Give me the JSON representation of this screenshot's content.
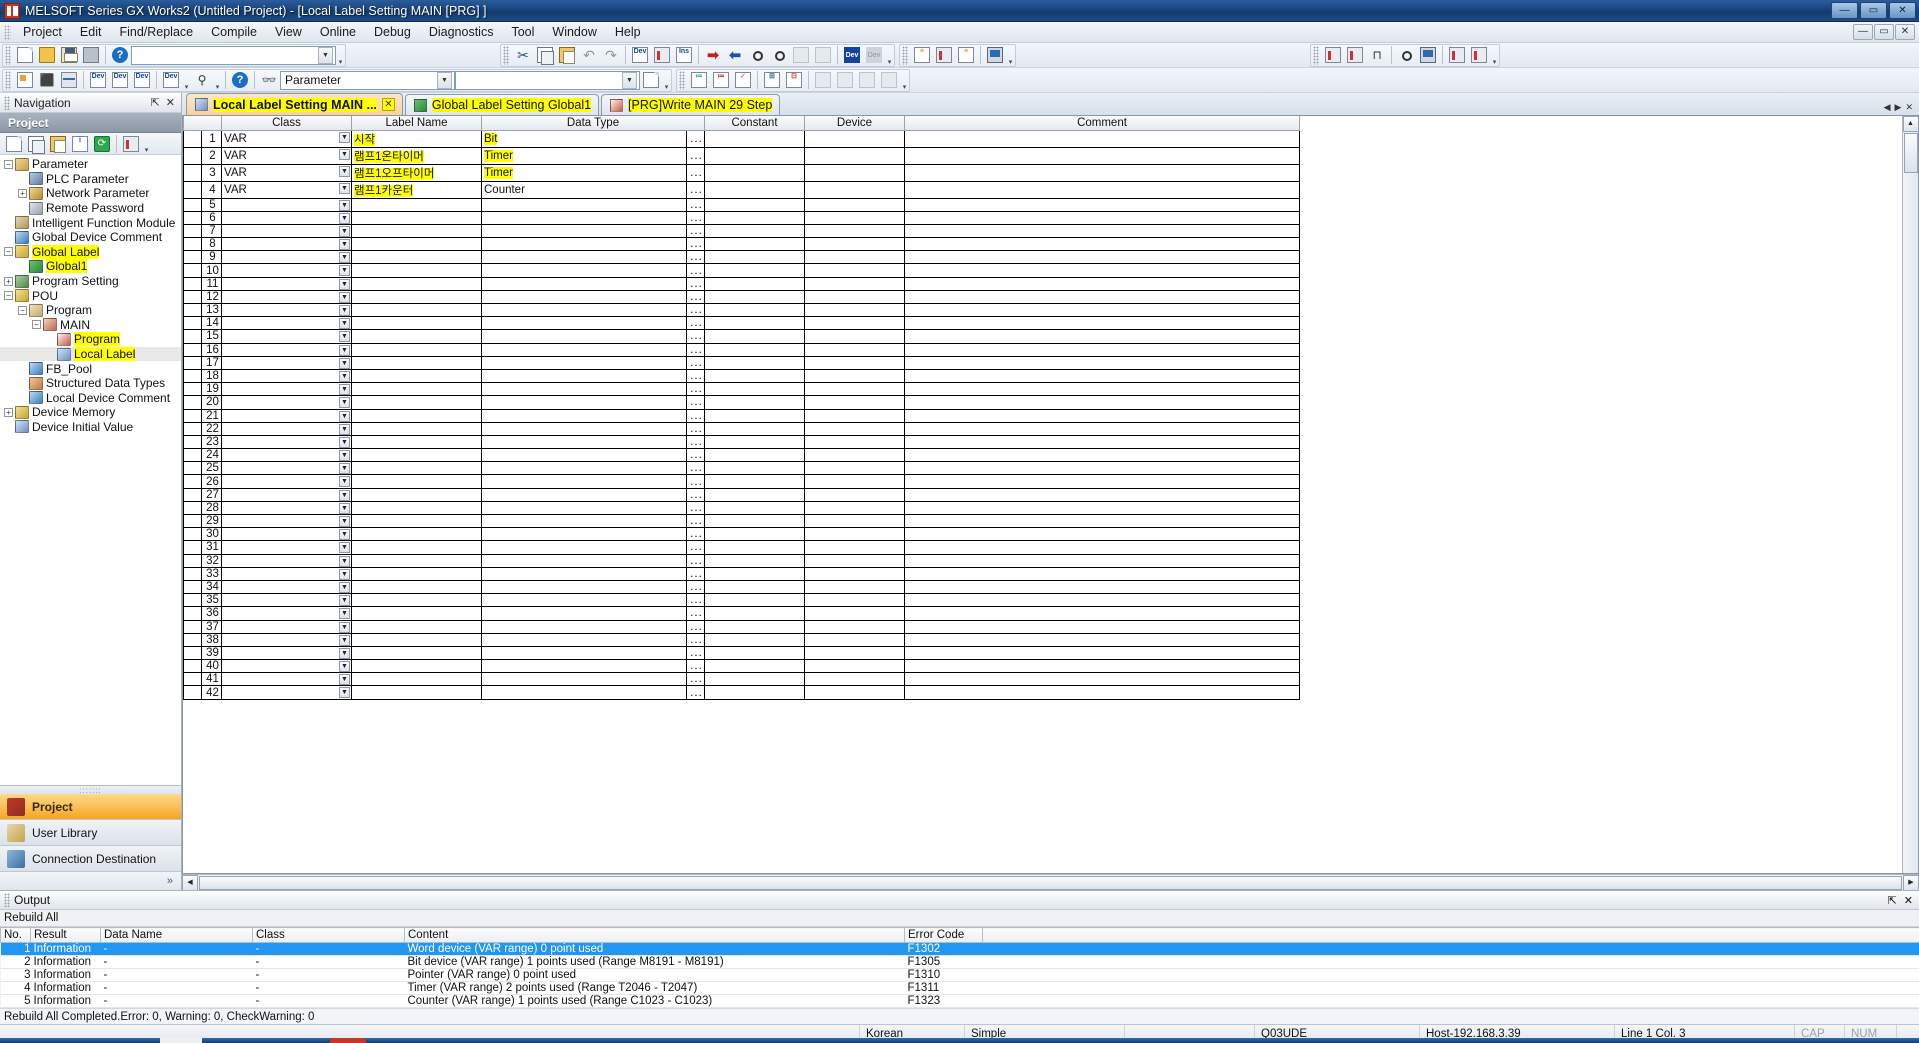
{
  "window": {
    "title": "MELSOFT Series GX Works2 (Untitled Project) - [Local Label Setting MAIN [PRG] ]",
    "app_icon": "gxworks-icon",
    "minimize": "—",
    "maximize": "▭",
    "close": "✕",
    "inner_minimize": "—",
    "inner_restore": "▭",
    "inner_close": "✕"
  },
  "menu": {
    "items": [
      {
        "label": "Project"
      },
      {
        "label": "Edit"
      },
      {
        "label": "Find/Replace"
      },
      {
        "label": "Compile"
      },
      {
        "label": "View"
      },
      {
        "label": "Online"
      },
      {
        "label": "Debug"
      },
      {
        "label": "Diagnostics"
      },
      {
        "label": "Tool"
      },
      {
        "label": "Window"
      },
      {
        "label": "Help"
      }
    ]
  },
  "toolbar": {
    "row1_group1": [
      {
        "name": "new-project-icon"
      },
      {
        "name": "open-project-icon"
      },
      {
        "name": "save-project-icon"
      },
      {
        "name": "print-icon"
      },
      {
        "name": "help-icon"
      }
    ],
    "row1_combo_value": "",
    "row1_group2": [
      {
        "name": "cut-icon"
      },
      {
        "name": "copy-icon"
      },
      {
        "name": "paste-icon"
      },
      {
        "name": "undo-icon"
      },
      {
        "name": "redo-icon"
      },
      {
        "name": "device-find-icon"
      },
      {
        "name": "device-replace-icon"
      },
      {
        "name": "instruction-find-icon"
      },
      {
        "name": "write-to-plc-icon"
      },
      {
        "name": "read-from-plc-icon"
      },
      {
        "name": "monitor-start-icon"
      },
      {
        "name": "monitor-stop-icon"
      },
      {
        "name": "monitor-write-disabled-icon"
      },
      {
        "name": "monitor-read-disabled-icon"
      },
      {
        "name": "device-batch-icon"
      },
      {
        "name": "device-batch-disabled-icon"
      }
    ],
    "row1_group3": [
      {
        "name": "compile-icon"
      },
      {
        "name": "rebuild-all-icon"
      },
      {
        "name": "online-change-icon"
      },
      {
        "name": "remote-operation-icon"
      }
    ],
    "row1_group4": [
      {
        "name": "step-run-icon"
      },
      {
        "name": "break-point-icon"
      },
      {
        "name": "step-execute-icon"
      },
      {
        "name": "sampling-trace-icon"
      },
      {
        "name": "scan-time-icon"
      },
      {
        "name": "simulation-start-icon"
      },
      {
        "name": "simulation-stop-icon"
      }
    ],
    "row2_group1": [
      {
        "name": "navigation-window-icon"
      },
      {
        "name": "function-block-icon"
      },
      {
        "name": "docking-window-icon"
      },
      {
        "name": "device-comment-icon"
      },
      {
        "name": "device-memory-icon"
      },
      {
        "name": "device-initial-value-icon"
      },
      {
        "name": "device-batch-replace-icon"
      },
      {
        "name": "device-test-icon"
      },
      {
        "name": "help-circle-icon"
      },
      {
        "name": "find-binoculars-icon"
      }
    ],
    "row2_combo_value": "Parameter",
    "row2_group2": [
      {
        "name": "label-setting-icon"
      },
      {
        "name": "label-delete-icon"
      },
      {
        "name": "label-check-icon"
      },
      {
        "name": "insert-row-icon"
      },
      {
        "name": "delete-row-icon"
      },
      {
        "name": "read-icon"
      },
      {
        "name": "copy-row-icon"
      },
      {
        "name": "paste-row-icon"
      },
      {
        "name": "sort-icon"
      }
    ]
  },
  "navigation": {
    "header": "Navigation",
    "pin_icon": "pin-icon",
    "close_icon": "close-icon",
    "section_title": "Project",
    "tools": [
      {
        "name": "new-data-icon"
      },
      {
        "name": "copy-data-icon"
      },
      {
        "name": "paste-data-icon"
      },
      {
        "name": "data-property-icon"
      },
      {
        "name": "refresh-icon"
      },
      {
        "name": "view-mode-icon"
      }
    ],
    "tree": [
      {
        "label": "Parameter",
        "indent": 0,
        "expander": "minus",
        "icon": "parameter-folder-icon",
        "highlight": false
      },
      {
        "label": "PLC Parameter",
        "indent": 1,
        "expander": "none",
        "icon": "plc-parameter-icon",
        "highlight": false
      },
      {
        "label": "Network Parameter",
        "indent": 1,
        "expander": "plus",
        "icon": "network-parameter-icon",
        "highlight": false
      },
      {
        "label": "Remote Password",
        "indent": 1,
        "expander": "none",
        "icon": "remote-password-icon",
        "highlight": false
      },
      {
        "label": "Intelligent Function Module",
        "indent": 0,
        "expander": "none",
        "icon": "intelligent-module-icon",
        "highlight": false
      },
      {
        "label": "Global Device Comment",
        "indent": 0,
        "expander": "none",
        "icon": "global-device-comment-icon",
        "highlight": false
      },
      {
        "label": "Global Label",
        "indent": 0,
        "expander": "minus",
        "icon": "global-label-icon",
        "highlight": true
      },
      {
        "label": "Global1",
        "indent": 1,
        "expander": "none",
        "icon": "global1-icon",
        "highlight": true
      },
      {
        "label": "Program Setting",
        "indent": 0,
        "expander": "plus",
        "icon": "program-setting-icon",
        "highlight": false
      },
      {
        "label": "POU",
        "indent": 0,
        "expander": "minus",
        "icon": "pou-icon",
        "highlight": false
      },
      {
        "label": "Program",
        "indent": 1,
        "expander": "minus",
        "icon": "program-folder-icon",
        "highlight": false
      },
      {
        "label": "MAIN",
        "indent": 2,
        "expander": "minus",
        "icon": "main-program-icon",
        "highlight": false
      },
      {
        "label": "Program",
        "indent": 3,
        "expander": "none",
        "icon": "ladder-program-icon",
        "highlight": true
      },
      {
        "label": "Local Label",
        "indent": 3,
        "expander": "none",
        "icon": "local-label-icon",
        "highlight": true,
        "selected": true
      },
      {
        "label": "FB_Pool",
        "indent": 1,
        "expander": "none",
        "icon": "fb-pool-icon",
        "highlight": false
      },
      {
        "label": "Structured Data Types",
        "indent": 1,
        "expander": "none",
        "icon": "structured-data-icon",
        "highlight": false
      },
      {
        "label": "Local Device Comment",
        "indent": 1,
        "expander": "none",
        "icon": "local-device-comment-icon",
        "highlight": false
      },
      {
        "label": "Device Memory",
        "indent": 0,
        "expander": "plus",
        "icon": "device-memory-icon",
        "highlight": false
      },
      {
        "label": "Device Initial Value",
        "indent": 0,
        "expander": "none",
        "icon": "device-initial-value-icon",
        "highlight": false
      }
    ],
    "bottom_items": [
      {
        "label": "Project",
        "icon": "project-icon",
        "active": true
      },
      {
        "label": "User Library",
        "icon": "user-library-icon",
        "active": false
      },
      {
        "label": "Connection Destination",
        "icon": "connection-destination-icon",
        "active": false
      }
    ],
    "expand_more": "»"
  },
  "tabs": [
    {
      "label": "Local Label Setting MAIN ...",
      "icon": "local-label-tab-icon",
      "active": true,
      "closable": true,
      "close_label": "✕",
      "highlight": true
    },
    {
      "label": "Global Label Setting Global1",
      "icon": "global-label-tab-icon",
      "active": false,
      "closable": false,
      "highlight": true
    },
    {
      "label": "[PRG]Write MAIN 29 Step",
      "icon": "ladder-tab-icon",
      "active": false,
      "closable": false,
      "highlight": true
    }
  ],
  "tab_nav": {
    "left": "◀",
    "right": "▶",
    "close": "✕"
  },
  "label_grid": {
    "columns": [
      "Class",
      "Label Name",
      "Data Type",
      "Constant",
      "Device",
      "Comment"
    ],
    "rows": [
      {
        "no": 1,
        "class": "VAR",
        "label_name": "시작",
        "data_type": "Bit",
        "constant": "",
        "device": "",
        "comment": "",
        "name_hl": true,
        "type_hl": true
      },
      {
        "no": 2,
        "class": "VAR",
        "label_name": "램프1온타이머",
        "data_type": "Timer",
        "constant": "",
        "device": "",
        "comment": "",
        "name_hl": true,
        "type_hl": true
      },
      {
        "no": 3,
        "class": "VAR",
        "label_name": "램프1오프타이머",
        "data_type": "Timer",
        "constant": "",
        "device": "",
        "comment": "",
        "name_hl": true,
        "type_hl": true
      },
      {
        "no": 4,
        "class": "VAR",
        "label_name": "램프1카운터",
        "data_type": "Counter",
        "constant": "",
        "device": "",
        "comment": "",
        "name_hl": true,
        "type_hl": false
      },
      {
        "no": 5,
        "class": "",
        "label_name": "",
        "data_type": "",
        "constant": "",
        "device": "",
        "comment": ""
      },
      {
        "no": 6,
        "class": "",
        "label_name": "",
        "data_type": "",
        "constant": "",
        "device": "",
        "comment": ""
      },
      {
        "no": 7,
        "class": "",
        "label_name": "",
        "data_type": "",
        "constant": "",
        "device": "",
        "comment": ""
      },
      {
        "no": 8,
        "class": "",
        "label_name": "",
        "data_type": "",
        "constant": "",
        "device": "",
        "comment": ""
      },
      {
        "no": 9,
        "class": "",
        "label_name": "",
        "data_type": "",
        "constant": "",
        "device": "",
        "comment": ""
      },
      {
        "no": 10,
        "class": "",
        "label_name": "",
        "data_type": "",
        "constant": "",
        "device": "",
        "comment": ""
      },
      {
        "no": 11,
        "class": "",
        "label_name": "",
        "data_type": "",
        "constant": "",
        "device": "",
        "comment": ""
      },
      {
        "no": 12,
        "class": "",
        "label_name": "",
        "data_type": "",
        "constant": "",
        "device": "",
        "comment": ""
      },
      {
        "no": 13,
        "class": "",
        "label_name": "",
        "data_type": "",
        "constant": "",
        "device": "",
        "comment": ""
      },
      {
        "no": 14,
        "class": "",
        "label_name": "",
        "data_type": "",
        "constant": "",
        "device": "",
        "comment": ""
      },
      {
        "no": 15,
        "class": "",
        "label_name": "",
        "data_type": "",
        "constant": "",
        "device": "",
        "comment": ""
      },
      {
        "no": 16,
        "class": "",
        "label_name": "",
        "data_type": "",
        "constant": "",
        "device": "",
        "comment": ""
      },
      {
        "no": 17,
        "class": "",
        "label_name": "",
        "data_type": "",
        "constant": "",
        "device": "",
        "comment": ""
      },
      {
        "no": 18,
        "class": "",
        "label_name": "",
        "data_type": "",
        "constant": "",
        "device": "",
        "comment": ""
      },
      {
        "no": 19,
        "class": "",
        "label_name": "",
        "data_type": "",
        "constant": "",
        "device": "",
        "comment": ""
      },
      {
        "no": 20,
        "class": "",
        "label_name": "",
        "data_type": "",
        "constant": "",
        "device": "",
        "comment": ""
      },
      {
        "no": 21,
        "class": "",
        "label_name": "",
        "data_type": "",
        "constant": "",
        "device": "",
        "comment": ""
      },
      {
        "no": 22,
        "class": "",
        "label_name": "",
        "data_type": "",
        "constant": "",
        "device": "",
        "comment": ""
      },
      {
        "no": 23,
        "class": "",
        "label_name": "",
        "data_type": "",
        "constant": "",
        "device": "",
        "comment": ""
      },
      {
        "no": 24,
        "class": "",
        "label_name": "",
        "data_type": "",
        "constant": "",
        "device": "",
        "comment": ""
      },
      {
        "no": 25,
        "class": "",
        "label_name": "",
        "data_type": "",
        "constant": "",
        "device": "",
        "comment": ""
      },
      {
        "no": 26,
        "class": "",
        "label_name": "",
        "data_type": "",
        "constant": "",
        "device": "",
        "comment": ""
      },
      {
        "no": 27,
        "class": "",
        "label_name": "",
        "data_type": "",
        "constant": "",
        "device": "",
        "comment": ""
      },
      {
        "no": 28,
        "class": "",
        "label_name": "",
        "data_type": "",
        "constant": "",
        "device": "",
        "comment": ""
      },
      {
        "no": 29,
        "class": "",
        "label_name": "",
        "data_type": "",
        "constant": "",
        "device": "",
        "comment": ""
      },
      {
        "no": 30,
        "class": "",
        "label_name": "",
        "data_type": "",
        "constant": "",
        "device": "",
        "comment": ""
      },
      {
        "no": 31,
        "class": "",
        "label_name": "",
        "data_type": "",
        "constant": "",
        "device": "",
        "comment": ""
      },
      {
        "no": 32,
        "class": "",
        "label_name": "",
        "data_type": "",
        "constant": "",
        "device": "",
        "comment": ""
      },
      {
        "no": 33,
        "class": "",
        "label_name": "",
        "data_type": "",
        "constant": "",
        "device": "",
        "comment": ""
      },
      {
        "no": 34,
        "class": "",
        "label_name": "",
        "data_type": "",
        "constant": "",
        "device": "",
        "comment": ""
      },
      {
        "no": 35,
        "class": "",
        "label_name": "",
        "data_type": "",
        "constant": "",
        "device": "",
        "comment": ""
      },
      {
        "no": 36,
        "class": "",
        "label_name": "",
        "data_type": "",
        "constant": "",
        "device": "",
        "comment": ""
      },
      {
        "no": 37,
        "class": "",
        "label_name": "",
        "data_type": "",
        "constant": "",
        "device": "",
        "comment": ""
      },
      {
        "no": 38,
        "class": "",
        "label_name": "",
        "data_type": "",
        "constant": "",
        "device": "",
        "comment": ""
      },
      {
        "no": 39,
        "class": "",
        "label_name": "",
        "data_type": "",
        "constant": "",
        "device": "",
        "comment": ""
      },
      {
        "no": 40,
        "class": "",
        "label_name": "",
        "data_type": "",
        "constant": "",
        "device": "",
        "comment": ""
      },
      {
        "no": 41,
        "class": "",
        "label_name": "",
        "data_type": "",
        "constant": "",
        "device": "",
        "comment": ""
      },
      {
        "no": 42,
        "class": "",
        "label_name": "",
        "data_type": "",
        "constant": "",
        "device": "",
        "comment": ""
      }
    ],
    "browse_cell": "...",
    "dropdown_glyph": "▼"
  },
  "output": {
    "header": "Output",
    "pin_icon": "pin-icon",
    "close_icon": "close-icon",
    "subheader": "Rebuild All",
    "columns": [
      "No.",
      "Result",
      "Data Name",
      "Class",
      "Content",
      "Error Code",
      ""
    ],
    "rows": [
      {
        "no": "1",
        "result": "Information",
        "data_name": "-",
        "class": "-",
        "content": "Word device (VAR range) 0 point used",
        "error_code": "F1302",
        "selected": true
      },
      {
        "no": "2",
        "result": "Information",
        "data_name": "-",
        "class": "-",
        "content": "Bit device (VAR range) 1 points used (Range M8191 - M8191)",
        "error_code": "F1305",
        "selected": false
      },
      {
        "no": "3",
        "result": "Information",
        "data_name": "-",
        "class": "-",
        "content": "Pointer (VAR range) 0 point used",
        "error_code": "F1310",
        "selected": false
      },
      {
        "no": "4",
        "result": "Information",
        "data_name": "-",
        "class": "-",
        "content": "Timer (VAR range) 2 points used (Range T2046 - T2047)",
        "error_code": "F1311",
        "selected": false
      },
      {
        "no": "5",
        "result": "Information",
        "data_name": "-",
        "class": "-",
        "content": "Counter (VAR range) 1 points used (Range C1023 - C1023)",
        "error_code": "F1323",
        "selected": false
      }
    ],
    "status_line": "Rebuild All Completed.Error: 0, Warning: 0, CheckWarning: 0"
  },
  "statusbar": {
    "language": "Korean",
    "mode": "Simple",
    "plc_type": "Q03UDE",
    "host": "Host-192.168.3.39",
    "cursor": "Line 1 Col. 3",
    "cap": "CAP",
    "num": "NUM"
  },
  "colors": {
    "highlight_yellow": "#ffff00",
    "selection_blue": "#2196f3",
    "title_blue": "#19457c",
    "accent_orange": "#f5a623",
    "gray_cell": "#c0c0c0"
  }
}
